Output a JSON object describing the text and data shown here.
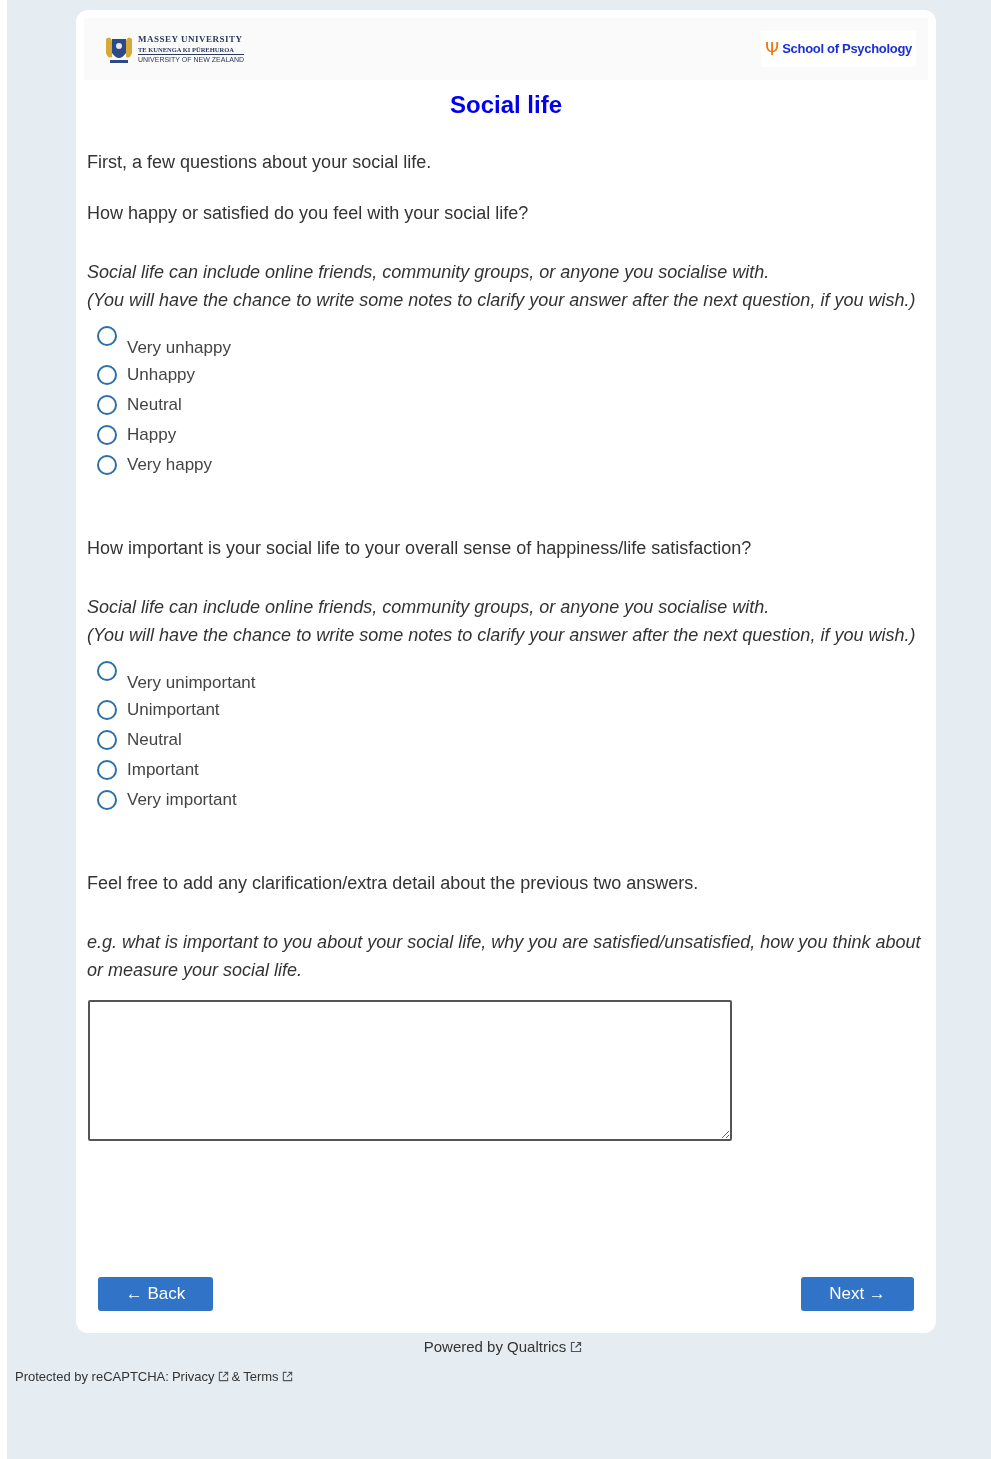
{
  "header": {
    "logo_lines": [
      "MASSEY UNIVERSITY",
      "TE KUNENGA KI PŪREHUROA",
      "UNIVERSITY OF NEW ZEALAND"
    ],
    "school": {
      "symbol": "Ψ",
      "name": "School of Psychology"
    }
  },
  "title": "Social life",
  "intro": "First, a few questions about your social life.",
  "questions": [
    {
      "kind": "radio",
      "prompt": "How happy or satisfied do you feel with your social life?",
      "note_lines": [
        "Social life can include online friends, community groups, or anyone you socialise with.",
        "(You will have the chance to write some notes to clarify your answer after the next question, if you wish.)"
      ],
      "options": [
        {
          "label": "Very unhappy",
          "selected": false
        },
        {
          "label": "Unhappy",
          "selected": false
        },
        {
          "label": "Neutral",
          "selected": false
        },
        {
          "label": "Happy",
          "selected": false
        },
        {
          "label": "Very happy",
          "selected": false
        }
      ]
    },
    {
      "kind": "radio",
      "prompt": "How important is your social life to your overall sense of happiness/life satisfaction?",
      "note_lines": [
        "Social life can include online friends, community groups, or anyone you socialise with.",
        "(You will have the chance to write some notes to clarify your answer after the next question, if you wish.)"
      ],
      "options": [
        {
          "label": "Very unimportant",
          "selected": false
        },
        {
          "label": "Unimportant",
          "selected": false
        },
        {
          "label": "Neutral",
          "selected": false
        },
        {
          "label": "Important",
          "selected": false
        },
        {
          "label": "Very important",
          "selected": false
        }
      ]
    },
    {
      "kind": "text",
      "prompt": "Feel free to add any clarification/extra detail about the previous two answers.",
      "note_lines": [
        "e.g. what is important to you about your social life, why you are satisfied/unsatisfied, how you think about or measure your social life."
      ]
    }
  ],
  "nav": {
    "back": "← Back",
    "next": "Next →"
  },
  "footer": {
    "powered": "Powered by Qualtrics",
    "recaptcha": "Protected by reCAPTCHA:",
    "privacy": "Privacy",
    "and": "&",
    "terms": "Terms"
  }
}
